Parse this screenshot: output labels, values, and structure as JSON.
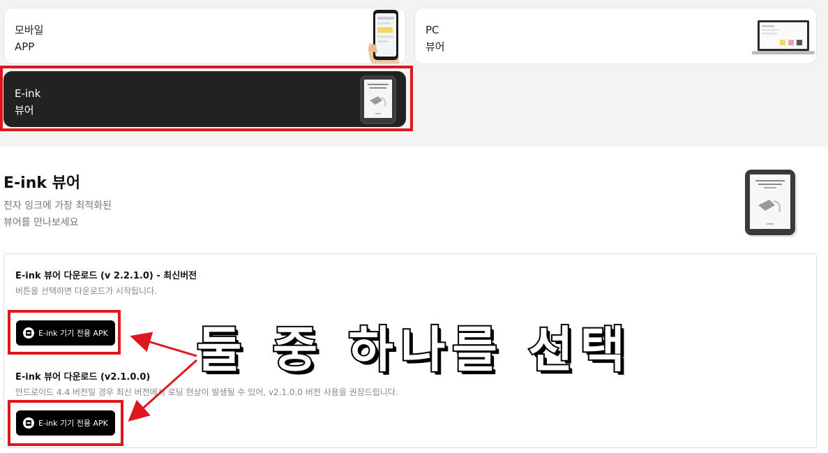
{
  "tabs": [
    {
      "line1": "모바일",
      "line2": "APP",
      "icon": "smartphone-in-hand-icon"
    },
    {
      "line1": "PC",
      "line2": "뷰어",
      "icon": "laptop-icon"
    },
    {
      "line1": "E-ink",
      "line2": "뷰어",
      "icon": "ereader-icon",
      "selected": true
    }
  ],
  "section": {
    "title": "E-ink 뷰어",
    "desc_line1": "전자 잉크에 가장 최적화된",
    "desc_line2": "뷰어를 만나보세요"
  },
  "downloads": [
    {
      "title": "E-ink 뷰어 다운로드 (v 2.2.1.0) - 최신버전",
      "desc": "버튼을 선택하면 다운로드가 시작됩니다.",
      "button_label": "E-ink 기기 전용 APK"
    },
    {
      "title": "E-ink 뷰어 다운로드 (v2.1.0.0)",
      "desc": "안드로이드 4.4 버전일 경우 최신 버전에서 로딩 현상이 발생될 수 있어, v2.1.0.0 버전 사용을 권장드립니다.",
      "button_label": "E-ink 기기 전용 APK"
    }
  ],
  "annotation": {
    "overlay_text": "둘 중 하나를 선택",
    "highlight_color": "#e0161f"
  }
}
